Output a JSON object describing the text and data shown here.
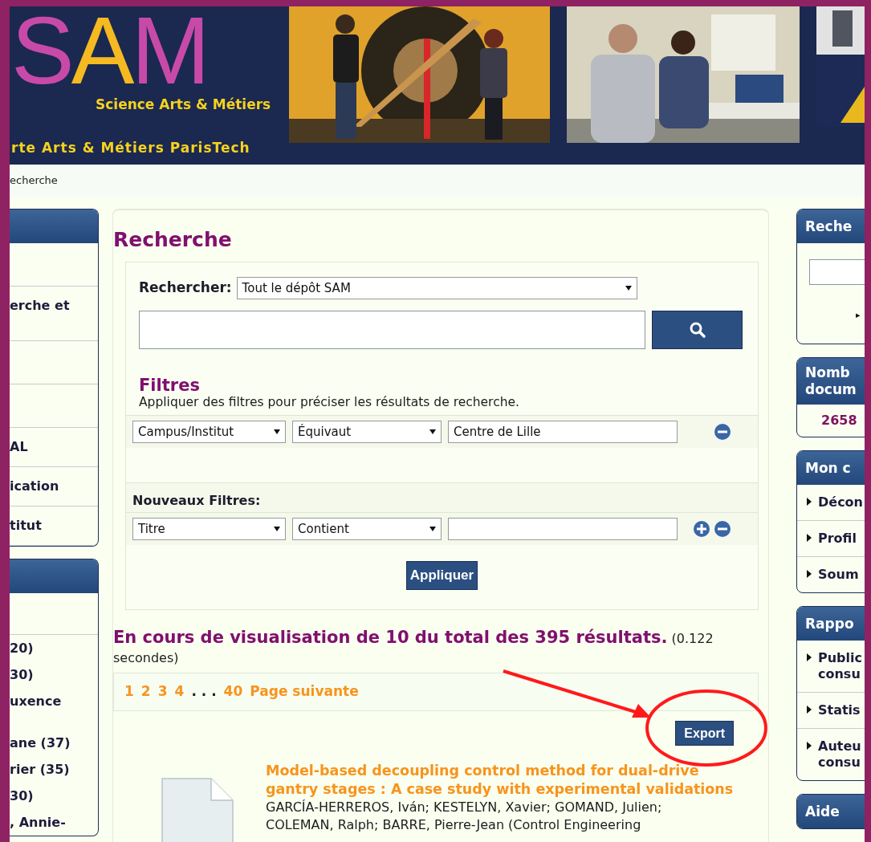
{
  "banner": {
    "logo_letters": [
      {
        "text": "S",
        "color": "#c84aa8"
      },
      {
        "text": "A",
        "color": "#f5b921"
      },
      {
        "text": "M",
        "color": "#c84aa8"
      }
    ],
    "tagline": "Science Arts & Métiers",
    "subtitle": "rte Arts & Métiers ParisTech"
  },
  "breadcrumb": "echerche",
  "left_sidebar": [
    {
      "items": [
        {
          "kind": "blank"
        },
        {
          "kind": "text",
          "label": "erche et"
        },
        {
          "kind": "blank"
        },
        {
          "kind": "blank"
        },
        {
          "kind": "text",
          "label": "AL"
        },
        {
          "kind": "text",
          "label": "ication"
        },
        {
          "kind": "text",
          "label": "titut"
        }
      ]
    },
    {
      "items": [
        {
          "kind": "blank"
        },
        {
          "kind": "line",
          "label": "20)"
        },
        {
          "kind": "line",
          "label": "30)"
        },
        {
          "kind": "line",
          "label": "uxence"
        },
        {
          "kind": "gap"
        },
        {
          "kind": "line",
          "label": "ane (37)"
        },
        {
          "kind": "line",
          "label": "rier (35)"
        },
        {
          "kind": "line",
          "label": "30)"
        },
        {
          "kind": "line",
          "label": ", Annie-"
        }
      ]
    }
  ],
  "search": {
    "title": "Recherche",
    "scope_label": "Rechercher:",
    "scope_value": "Tout le dépôt SAM",
    "filters_title": "Filtres",
    "filters_hint": "Appliquer des filtres pour préciser les résultats de recherche.",
    "filters": [
      {
        "field": "Campus/Institut",
        "operator": "Équivaut",
        "value": "Centre de Lille",
        "add": false
      }
    ],
    "new_filters_title": "Nouveaux Filtres:",
    "new_filters": [
      {
        "field": "Titre",
        "operator": "Contient",
        "add": true
      }
    ],
    "apply_button": "Appliquer"
  },
  "results": {
    "summary": "En cours de visualisation de 10 du total des 395 résultats.",
    "timing": "(0.122 secondes)",
    "pages": [
      {
        "label": "1",
        "kind": "link"
      },
      {
        "label": "2",
        "kind": "link"
      },
      {
        "label": "3",
        "kind": "link"
      },
      {
        "label": "4",
        "kind": "link"
      },
      {
        "label": ". . .",
        "kind": "ellipsis"
      },
      {
        "label": "40",
        "kind": "link"
      },
      {
        "label": "Page suivante",
        "kind": "link"
      }
    ],
    "export_button": "Export",
    "items": [
      {
        "title": "Model-based decoupling control method for dual-drive gantry stages : A case study with experimental validations",
        "authors": "GARCÍA-HERREROS, Iván; KESTELYN, Xavier; GOMAND, Julien;",
        "authors_more": "COLEMAN, Ralph; BARRE, Pierre-Jean (Control Engineering"
      }
    ]
  },
  "right_sidebar": [
    {
      "title": "Reche",
      "kind": "search",
      "items": [
        {
          "label": "▸"
        }
      ]
    },
    {
      "title": "Nomb docum",
      "kind": "count",
      "value": "2658"
    },
    {
      "title": "Mon c",
      "kind": "list",
      "items": [
        {
          "label": "Décon"
        },
        {
          "label": "Profil"
        },
        {
          "label": "Soum"
        }
      ]
    },
    {
      "title": "Rappo",
      "kind": "list",
      "items": [
        {
          "label": "Public consu"
        },
        {
          "label": "Statis"
        },
        {
          "label": "Auteu consu"
        }
      ]
    },
    {
      "title": "Aide",
      "kind": "header"
    }
  ]
}
